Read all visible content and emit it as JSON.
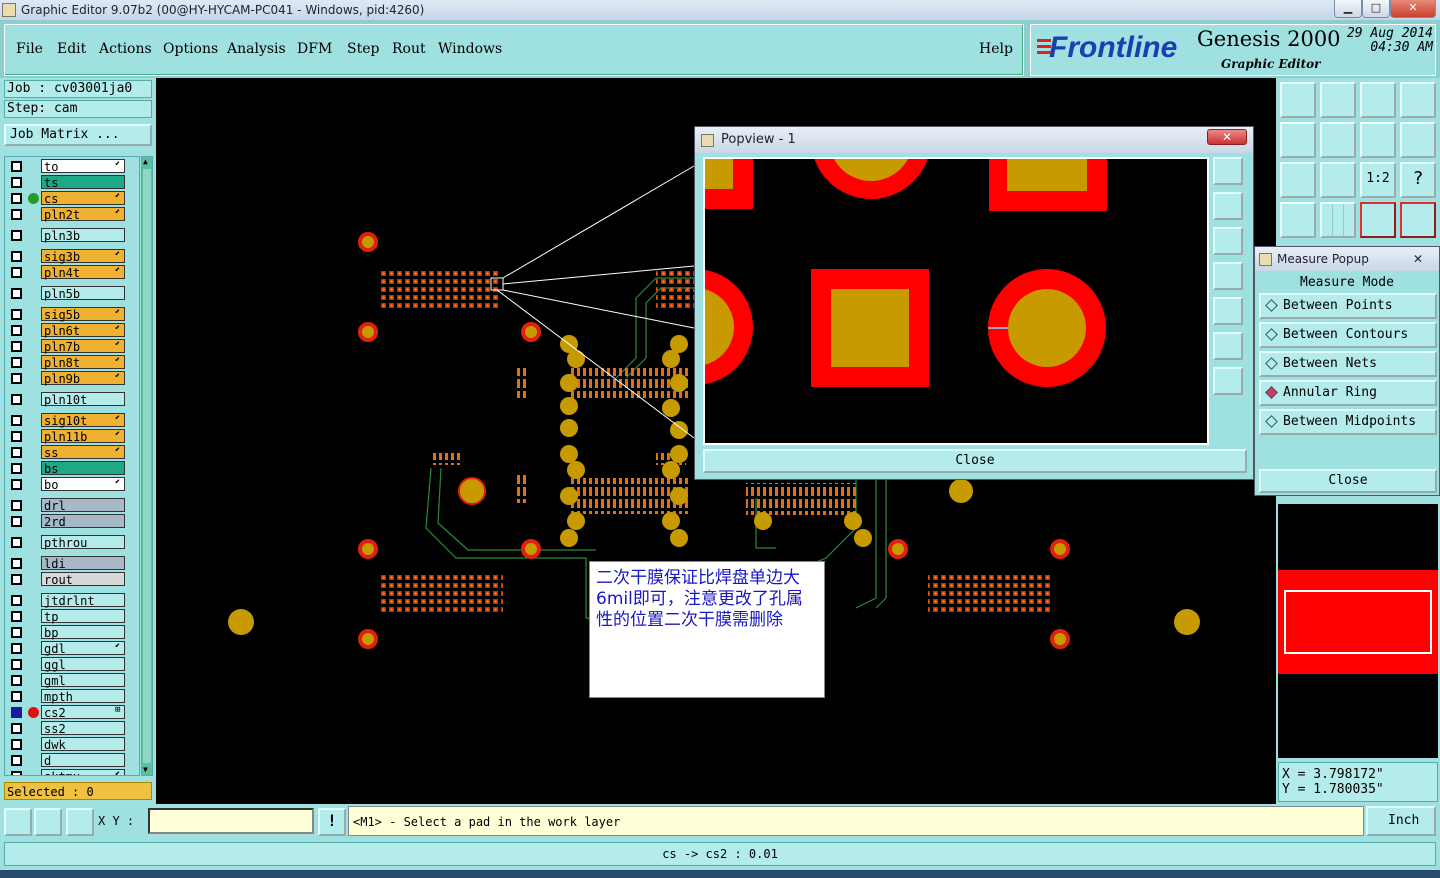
{
  "window": {
    "title": "Graphic Editor 9.07b2 (00@HY-HYCAM-PC041 - Windows, pid:4260)",
    "min": "▁",
    "max": "□",
    "close": "✕"
  },
  "menu": [
    "File",
    "Edit",
    "Actions",
    "Options",
    "Analysis",
    "DFM",
    "Step",
    "Rout",
    "Windows"
  ],
  "help": "Help",
  "brand": {
    "logo": "Frontline",
    "product": "Genesis 2000",
    "subtitle": "Graphic Editor",
    "date": "29 Aug 2014",
    "time": "04:30 AM"
  },
  "job": "Job : cv03001ja0",
  "step": "Step: cam",
  "job_matrix": "Job Matrix ...",
  "layers": [
    {
      "name": "to",
      "color": "#ffffff",
      "edit": "⬋",
      "dot": ""
    },
    {
      "name": "ts",
      "color": "#1fa885",
      "edit": "",
      "dot": ""
    },
    {
      "name": "cs",
      "color": "#f0b030",
      "edit": "⬋",
      "dot": "#2a9a2a"
    },
    {
      "name": "pln2t",
      "color": "#f0b030",
      "edit": "⬋",
      "dot": ""
    },
    {
      "name": "pln3b",
      "color": "#b4ecec",
      "edit": "",
      "dot": "",
      "gap": true
    },
    {
      "name": "sig3b",
      "color": "#f0b030",
      "edit": "⬋",
      "dot": "",
      "gap": true
    },
    {
      "name": "pln4t",
      "color": "#f0b030",
      "edit": "⬋",
      "dot": ""
    },
    {
      "name": "pln5b",
      "color": "#b4ecec",
      "edit": "",
      "dot": "",
      "gap": true
    },
    {
      "name": "sig5b",
      "color": "#f0b030",
      "edit": "⬋",
      "dot": "",
      "gap": true
    },
    {
      "name": "pln6t",
      "color": "#f0b030",
      "edit": "⬋",
      "dot": ""
    },
    {
      "name": "pln7b",
      "color": "#f0b030",
      "edit": "⬋",
      "dot": ""
    },
    {
      "name": "pln8t",
      "color": "#f0b030",
      "edit": "⬋",
      "dot": ""
    },
    {
      "name": "pln9b",
      "color": "#f0b030",
      "edit": "⬋",
      "dot": ""
    },
    {
      "name": "pln10t",
      "color": "#b4ecec",
      "edit": "",
      "dot": "",
      "gap": true
    },
    {
      "name": "sig10t",
      "color": "#f0b030",
      "edit": "⬋",
      "dot": "",
      "gap": true
    },
    {
      "name": "pln11b",
      "color": "#f0b030",
      "edit": "⬋",
      "dot": ""
    },
    {
      "name": "ss",
      "color": "#f0b030",
      "edit": "⬋",
      "dot": ""
    },
    {
      "name": "bs",
      "color": "#1fa885",
      "edit": "",
      "dot": ""
    },
    {
      "name": "bo",
      "color": "#ffffff",
      "edit": "⬋",
      "dot": ""
    },
    {
      "name": "drl",
      "color": "#a8b8c8",
      "edit": "",
      "dot": "",
      "gap": true
    },
    {
      "name": "2rd",
      "color": "#a8b8c8",
      "edit": "",
      "dot": ""
    },
    {
      "name": "pthrou",
      "color": "#b4ecec",
      "edit": "",
      "dot": "",
      "gap": true
    },
    {
      "name": "ldi",
      "color": "#a8b8c8",
      "edit": "",
      "dot": "",
      "gap": true
    },
    {
      "name": "rout",
      "color": "#d8d8d8",
      "edit": "",
      "dot": ""
    },
    {
      "name": "jtdrlnt",
      "color": "#b4ecec",
      "edit": "",
      "dot": "",
      "gap": true
    },
    {
      "name": "tp",
      "color": "#b4ecec",
      "edit": "",
      "dot": ""
    },
    {
      "name": "bp",
      "color": "#b4ecec",
      "edit": "",
      "dot": ""
    },
    {
      "name": "gdl",
      "color": "#b4ecec",
      "edit": "⬋",
      "dot": ""
    },
    {
      "name": "ggl",
      "color": "#b4ecec",
      "edit": "",
      "dot": ""
    },
    {
      "name": "gml",
      "color": "#b4ecec",
      "edit": "",
      "dot": ""
    },
    {
      "name": "mpth",
      "color": "#b4ecec",
      "edit": "",
      "dot": ""
    },
    {
      "name": "cs2",
      "color": "#b4ecec",
      "edit": "⊞",
      "dot": "#e01010",
      "active": true
    },
    {
      "name": "ss2",
      "color": "#b4ecec",
      "edit": "",
      "dot": ""
    },
    {
      "name": "dwk",
      "color": "#b4ecec",
      "edit": "",
      "dot": ""
    },
    {
      "name": "d",
      "color": "#b4ecec",
      "edit": "",
      "dot": ""
    },
    {
      "name": "sktmx",
      "color": "#b4ecec",
      "edit": "⬋",
      "dot": ""
    }
  ],
  "selected": "Selected : 0",
  "popview": {
    "title": "Popview - 1",
    "close": "Close"
  },
  "measure": {
    "title": "Measure Popup",
    "mode_label": "Measure Mode",
    "options": [
      {
        "label": "Between Points",
        "on": false
      },
      {
        "label": "Between Contours",
        "on": false
      },
      {
        "label": "Between Nets",
        "on": false
      },
      {
        "label": "Annular Ring",
        "on": true
      },
      {
        "label": "Between Midpoints",
        "on": false
      }
    ],
    "close": "Close"
  },
  "coords": {
    "x": "X = 3.798172\"",
    "y": "Y = 1.780035\""
  },
  "note": "二次干膜保证比焊盘单边大6mil即可，注意更改了孔属性的位置二次干膜需删除",
  "bottom": {
    "xy_label": "X Y :",
    "xy_value": "",
    "warn": "!",
    "message": "<M1> - Select a pad in the work layer",
    "units": "Inch",
    "status": "cs -> cs2 : 0.01"
  }
}
